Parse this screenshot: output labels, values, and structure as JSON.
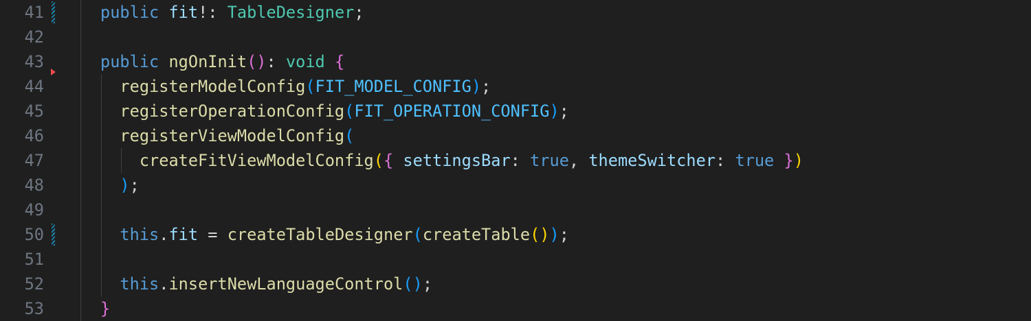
{
  "editor": {
    "lines": [
      {
        "number": "41",
        "dirty": true,
        "tokens": [
          {
            "t": "public",
            "c": "kw"
          },
          {
            "t": " ",
            "c": "pn"
          },
          {
            "t": "fit",
            "c": "var"
          },
          {
            "t": "!: ",
            "c": "pn"
          },
          {
            "t": "TableDesigner",
            "c": "ty"
          },
          {
            "t": ";",
            "c": "pn"
          }
        ]
      },
      {
        "number": "42",
        "tokens": []
      },
      {
        "number": "43",
        "tokens": [
          {
            "t": "public",
            "c": "kw"
          },
          {
            "t": " ",
            "c": "pn"
          },
          {
            "t": "ngOnInit",
            "c": "fn"
          },
          {
            "t": "()",
            "c": "b2"
          },
          {
            "t": ": ",
            "c": "pn"
          },
          {
            "t": "void",
            "c": "ty"
          },
          {
            "t": " ",
            "c": "pn"
          },
          {
            "t": "{",
            "c": "b2"
          }
        ]
      },
      {
        "number": "44",
        "deleted_above": true,
        "tokens": [
          {
            "t": "  ",
            "c": "pn"
          },
          {
            "t": "registerModelConfig",
            "c": "fn"
          },
          {
            "t": "(",
            "c": "b3"
          },
          {
            "t": "FIT_MODEL_CONFIG",
            "c": "cst"
          },
          {
            "t": ")",
            "c": "b3"
          },
          {
            "t": ";",
            "c": "pn"
          }
        ]
      },
      {
        "number": "45",
        "tokens": [
          {
            "t": "  ",
            "c": "pn"
          },
          {
            "t": "registerOperationConfig",
            "c": "fn"
          },
          {
            "t": "(",
            "c": "b3"
          },
          {
            "t": "FIT_OPERATION_CONFIG",
            "c": "cst"
          },
          {
            "t": ")",
            "c": "b3"
          },
          {
            "t": ";",
            "c": "pn"
          }
        ]
      },
      {
        "number": "46",
        "tokens": [
          {
            "t": "  ",
            "c": "pn"
          },
          {
            "t": "registerViewModelConfig",
            "c": "fn"
          },
          {
            "t": "(",
            "c": "b3"
          }
        ]
      },
      {
        "number": "47",
        "tokens": [
          {
            "t": "    ",
            "c": "pn"
          },
          {
            "t": "createFitViewModelConfig",
            "c": "fn"
          },
          {
            "t": "(",
            "c": "b1"
          },
          {
            "t": "{",
            "c": "b2"
          },
          {
            "t": " ",
            "c": "pn"
          },
          {
            "t": "settingsBar",
            "c": "var"
          },
          {
            "t": ": ",
            "c": "pn"
          },
          {
            "t": "true",
            "c": "kw"
          },
          {
            "t": ", ",
            "c": "pn"
          },
          {
            "t": "themeSwitcher",
            "c": "var"
          },
          {
            "t": ": ",
            "c": "pn"
          },
          {
            "t": "true",
            "c": "kw"
          },
          {
            "t": " ",
            "c": "pn"
          },
          {
            "t": "}",
            "c": "b2"
          },
          {
            "t": ")",
            "c": "b1"
          }
        ]
      },
      {
        "number": "48",
        "tokens": [
          {
            "t": "  ",
            "c": "pn"
          },
          {
            "t": ")",
            "c": "b3"
          },
          {
            "t": ";",
            "c": "pn"
          }
        ]
      },
      {
        "number": "49",
        "tokens": []
      },
      {
        "number": "50",
        "dirty": true,
        "tokens": [
          {
            "t": "  ",
            "c": "pn"
          },
          {
            "t": "this",
            "c": "kw"
          },
          {
            "t": ".",
            "c": "pn"
          },
          {
            "t": "fit",
            "c": "var"
          },
          {
            "t": " = ",
            "c": "pn"
          },
          {
            "t": "createTableDesigner",
            "c": "fn"
          },
          {
            "t": "(",
            "c": "b3"
          },
          {
            "t": "createTable",
            "c": "fn"
          },
          {
            "t": "()",
            "c": "b1"
          },
          {
            "t": ")",
            "c": "b3"
          },
          {
            "t": ";",
            "c": "pn"
          }
        ]
      },
      {
        "number": "51",
        "tokens": []
      },
      {
        "number": "52",
        "tokens": [
          {
            "t": "  ",
            "c": "pn"
          },
          {
            "t": "this",
            "c": "kw"
          },
          {
            "t": ".",
            "c": "pn"
          },
          {
            "t": "insertNewLanguageControl",
            "c": "fn"
          },
          {
            "t": "()",
            "c": "b3"
          },
          {
            "t": ";",
            "c": "pn"
          }
        ]
      },
      {
        "number": "53",
        "tokens": [
          {
            "t": "}",
            "c": "b2"
          }
        ]
      }
    ],
    "colors": {
      "background": "#1f1f1f",
      "line_number": "#6e7681",
      "keyword": "#569cd6",
      "function": "#dcdcaa",
      "type": "#4ec9b0",
      "variable": "#9cdcfe",
      "constant": "#4fc1ff",
      "bracket_gold": "#ffd700",
      "bracket_orchid": "#da70d6",
      "bracket_blue": "#179fff",
      "dirty_marker": "#1b81a8",
      "deleted_marker": "#f14c4c"
    }
  }
}
